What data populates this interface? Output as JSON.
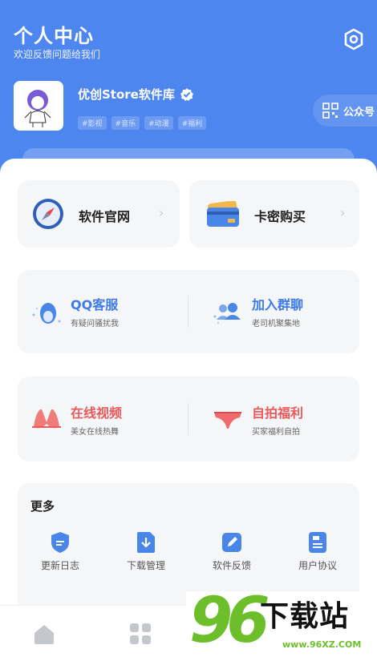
{
  "header": {
    "title": "个人中心",
    "subtitle": "欢迎反馈问题给我们",
    "settings_icon": "gear-icon"
  },
  "profile": {
    "name": "优创Store软件库",
    "verified_icon": "verified-badge-icon",
    "tags": [
      "#影视",
      "#音乐",
      "#动漫",
      "#福利"
    ],
    "official_account_label": "公众号"
  },
  "quick_cards": [
    {
      "label": "软件官网",
      "icon": "safari-compass-icon"
    },
    {
      "label": "卡密购买",
      "icon": "credit-card-icon"
    }
  ],
  "service_row_1": [
    {
      "title": "QQ客服",
      "subtitle": "有疑问骚扰我",
      "color": "#3d7bea",
      "icon": "qq-penguin-icon"
    },
    {
      "title": "加入群聊",
      "subtitle": "老司机聚集地",
      "color": "#3d7bea",
      "icon": "group-users-icon"
    }
  ],
  "service_row_2": [
    {
      "title": "在线视频",
      "subtitle": "美女在线热舞",
      "color": "#e95a5a",
      "icon": "bikini-top-icon"
    },
    {
      "title": "自拍福利",
      "subtitle": "买家福利自拍",
      "color": "#e95a5a",
      "icon": "underwear-icon"
    }
  ],
  "more": {
    "title": "更多",
    "items": [
      {
        "label": "更新日志",
        "icon": "shield-icon"
      },
      {
        "label": "下载管理",
        "icon": "download-icon"
      },
      {
        "label": "软件反馈",
        "icon": "edit-icon"
      },
      {
        "label": "用户协议",
        "icon": "document-icon"
      }
    ]
  },
  "tabbar": {
    "tabs": [
      {
        "icon": "home-icon"
      },
      {
        "icon": "apps-grid-icon"
      }
    ]
  },
  "watermark": {
    "number": "96",
    "text": "下载站",
    "url": "www.96XZ.COM"
  },
  "colors": {
    "header_blue": "#4d86ee",
    "accent_blue": "#3d7bea",
    "accent_red": "#e95a5a",
    "card_bg": "#f5f6f8"
  }
}
